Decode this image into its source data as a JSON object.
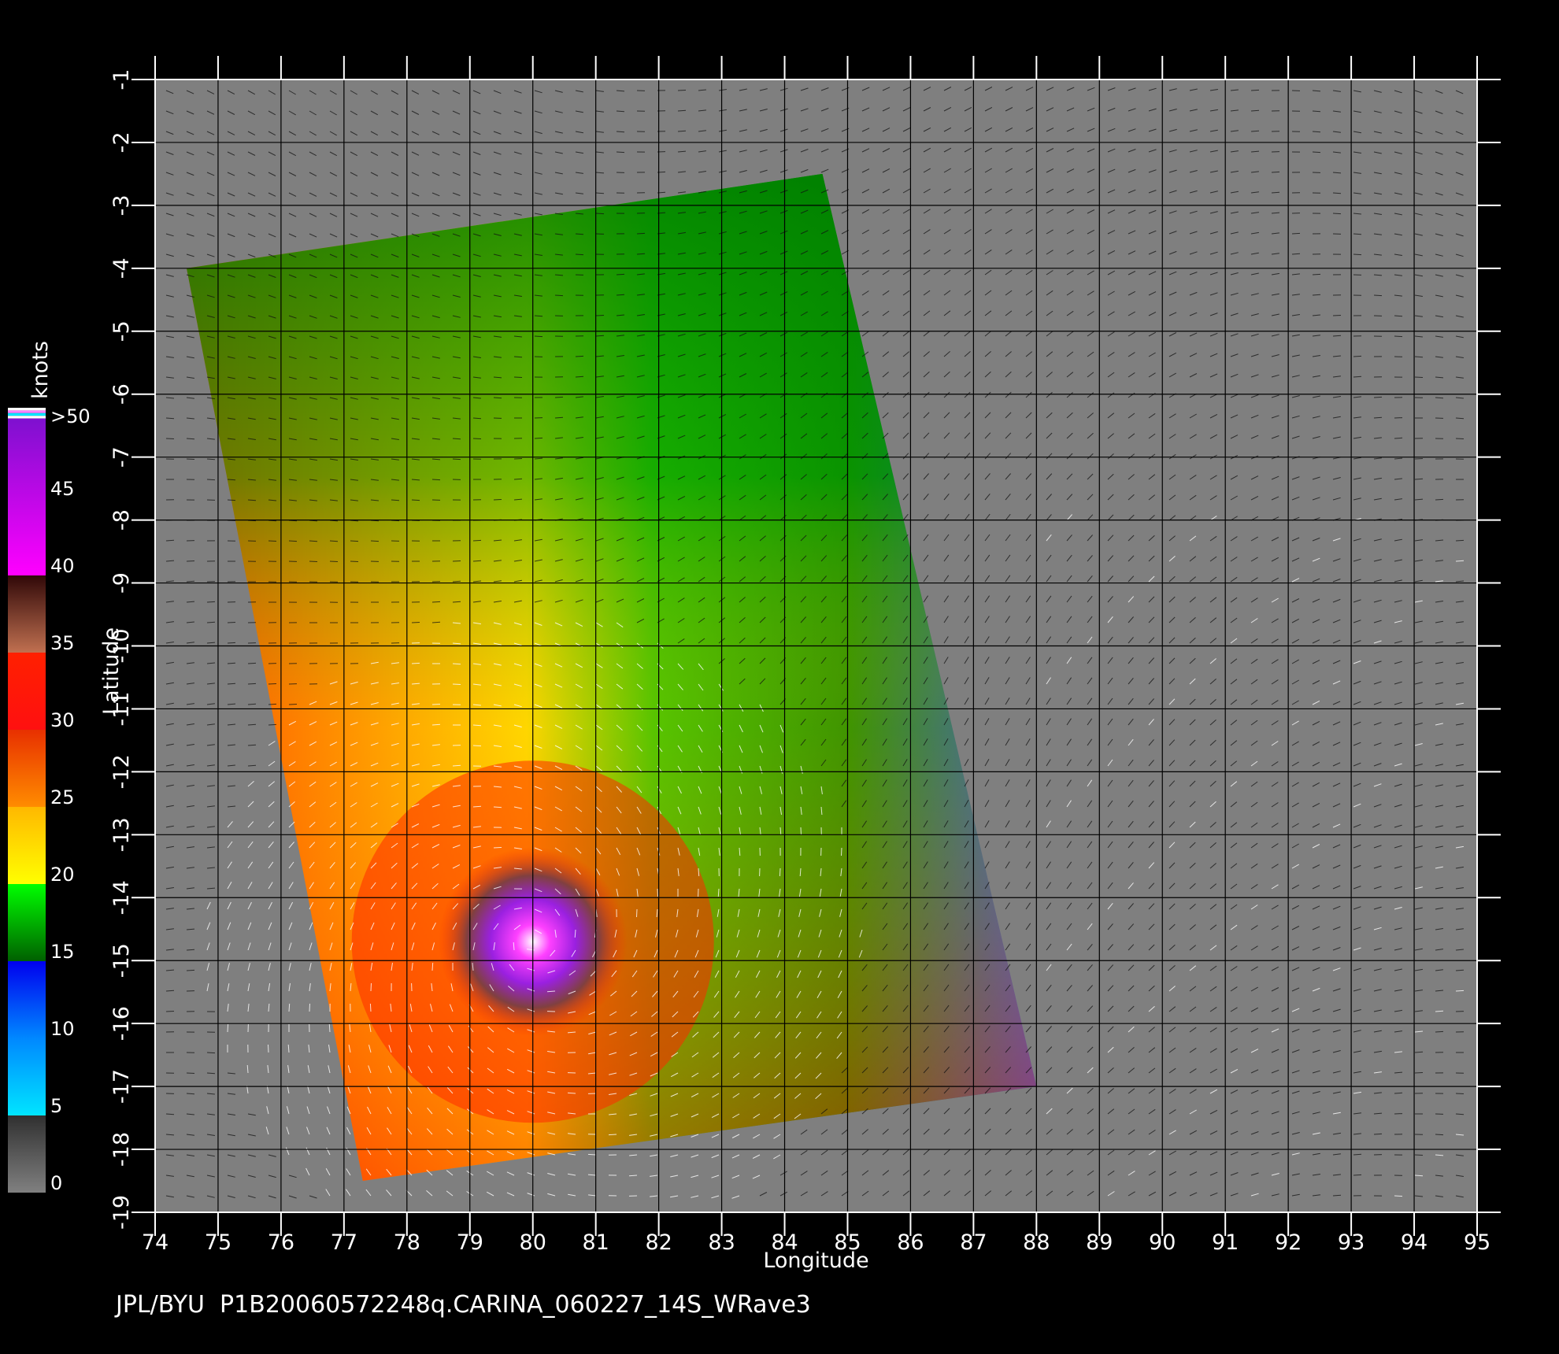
{
  "map": {
    "x_axis": {
      "label": "Longitude",
      "range": [
        74,
        95
      ],
      "ticks": [
        "74",
        "75",
        "76",
        "77",
        "78",
        "79",
        "80",
        "81",
        "82",
        "83",
        "84",
        "85",
        "86",
        "87",
        "88",
        "89",
        "90",
        "91",
        "92",
        "93",
        "94",
        "95"
      ]
    },
    "y_axis": {
      "label": "Latitude",
      "range": [
        -19,
        -1
      ],
      "ticks": [
        "-1",
        "-2",
        "-3",
        "-4",
        "-5",
        "-6",
        "-7",
        "-8",
        "-9",
        "-10",
        "-11",
        "-12",
        "-13",
        "-14",
        "-15",
        "-16",
        "-17",
        "-18",
        "-19"
      ]
    },
    "grid": true,
    "land_fill": "#7f7f7f",
    "swath_corners_lonlat": [
      [
        74.5,
        -4.0
      ],
      [
        84.6,
        -2.5
      ],
      [
        88.0,
        -17.0
      ],
      [
        77.3,
        -18.5
      ]
    ],
    "storm_center_lonlat": [
      80.0,
      -14.7
    ]
  },
  "colorbar": {
    "unit": "knots",
    "labels": [
      ">50",
      "45",
      "40",
      "35",
      "30",
      "25",
      "20",
      "15",
      "10",
      "5",
      "0"
    ],
    "stops": [
      {
        "value": 0,
        "color": "#808080"
      },
      {
        "value": 5,
        "color": "#303030"
      },
      {
        "value": 5,
        "color": "#00e5ff"
      },
      {
        "value": 10,
        "color": "#0088ff"
      },
      {
        "value": 15,
        "color": "#0000ee"
      },
      {
        "value": 15,
        "color": "#006000"
      },
      {
        "value": 20,
        "color": "#00ff00"
      },
      {
        "value": 20,
        "color": "#ffff00"
      },
      {
        "value": 25,
        "color": "#ffb800"
      },
      {
        "value": 25,
        "color": "#ff8c00"
      },
      {
        "value": 30,
        "color": "#e83000"
      },
      {
        "value": 30,
        "color": "#ff1010"
      },
      {
        "value": 35,
        "color": "#ff2000"
      },
      {
        "value": 35,
        "color": "#c07050"
      },
      {
        "value": 40,
        "color": "#300808"
      },
      {
        "value": 40,
        "color": "#ff00ff"
      },
      {
        "value": 50,
        "color": "#8010d0"
      }
    ]
  },
  "footer": {
    "text": "JPL/BYU  P1B20060572248q.CARINA_060227_14S_WRave3"
  }
}
